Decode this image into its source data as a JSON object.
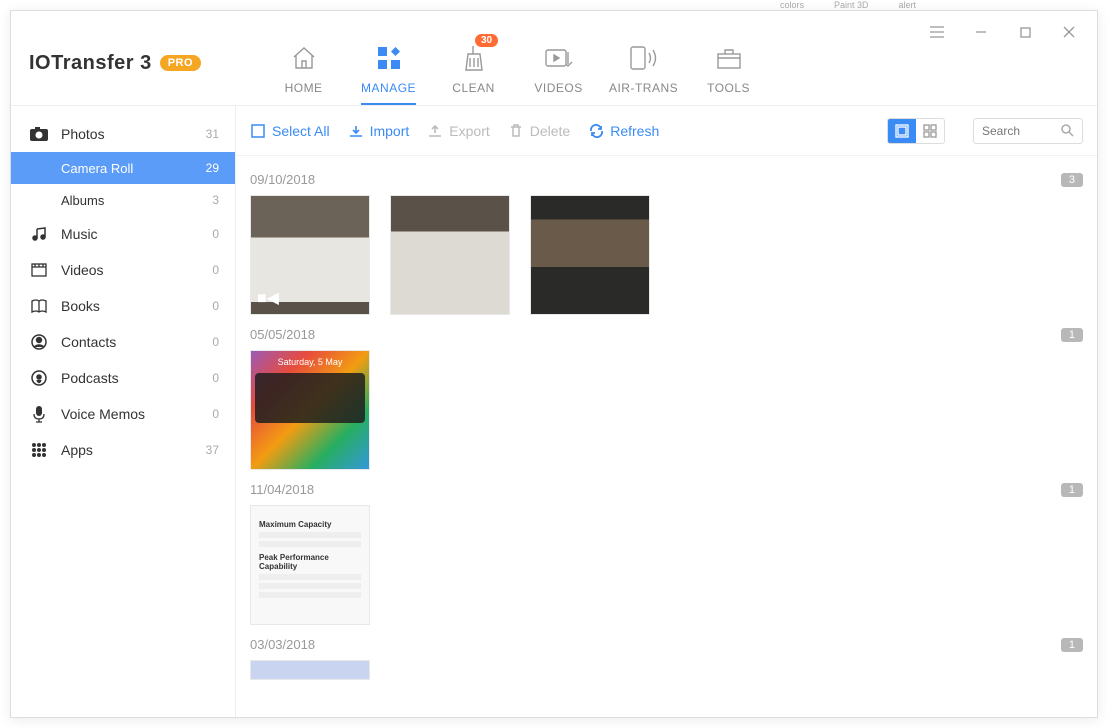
{
  "app": {
    "name": "IOTransfer 3",
    "edition": "PRO"
  },
  "nav": {
    "items": [
      {
        "key": "home",
        "label": "HOME"
      },
      {
        "key": "manage",
        "label": "MANAGE",
        "active": true
      },
      {
        "key": "clean",
        "label": "CLEAN",
        "badge": "30"
      },
      {
        "key": "videos",
        "label": "VIDEOS"
      },
      {
        "key": "airtrans",
        "label": "AIR-TRANS"
      },
      {
        "key": "tools",
        "label": "TOOLS"
      }
    ]
  },
  "sidebar": {
    "photos": {
      "label": "Photos",
      "count": "31"
    },
    "camera_roll": {
      "label": "Camera Roll",
      "count": "29"
    },
    "albums": {
      "label": "Albums",
      "count": "3"
    },
    "music": {
      "label": "Music",
      "count": "0"
    },
    "videos": {
      "label": "Videos",
      "count": "0"
    },
    "books": {
      "label": "Books",
      "count": "0"
    },
    "contacts": {
      "label": "Contacts",
      "count": "0"
    },
    "podcasts": {
      "label": "Podcasts",
      "count": "0"
    },
    "voice": {
      "label": "Voice Memos",
      "count": "0"
    },
    "apps": {
      "label": "Apps",
      "count": "37"
    }
  },
  "toolbar": {
    "select_all": "Select All",
    "import": "Import",
    "export": "Export",
    "delete": "Delete",
    "refresh": "Refresh"
  },
  "search": {
    "placeholder": "Search"
  },
  "gallery": {
    "groups": [
      {
        "date": "09/10/2018",
        "count": "3"
      },
      {
        "date": "05/05/2018",
        "count": "1"
      },
      {
        "date": "11/04/2018",
        "count": "1"
      },
      {
        "date": "03/03/2018",
        "count": "1"
      }
    ]
  },
  "ghost_tabs": {
    "colors": "colors",
    "paint": "Paint 3D",
    "alert": "alert"
  }
}
